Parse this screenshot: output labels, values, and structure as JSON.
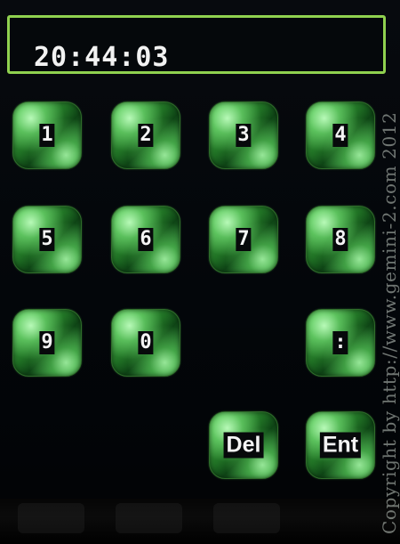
{
  "display": {
    "value": "20:44:03"
  },
  "keypad": {
    "key_1": "1",
    "key_2": "2",
    "key_3": "3",
    "key_4": "4",
    "key_5": "5",
    "key_6": "6",
    "key_7": "7",
    "key_8": "8",
    "key_9": "9",
    "key_0": "0",
    "key_colon": ":",
    "key_del": "Del",
    "key_ent": "Ent"
  },
  "watermark": {
    "text": "Copyright by http://www.gemini-2.com 2012"
  },
  "colors": {
    "display_border": "#8fd14f",
    "key_green": "#3fa447",
    "background": "#000000"
  }
}
